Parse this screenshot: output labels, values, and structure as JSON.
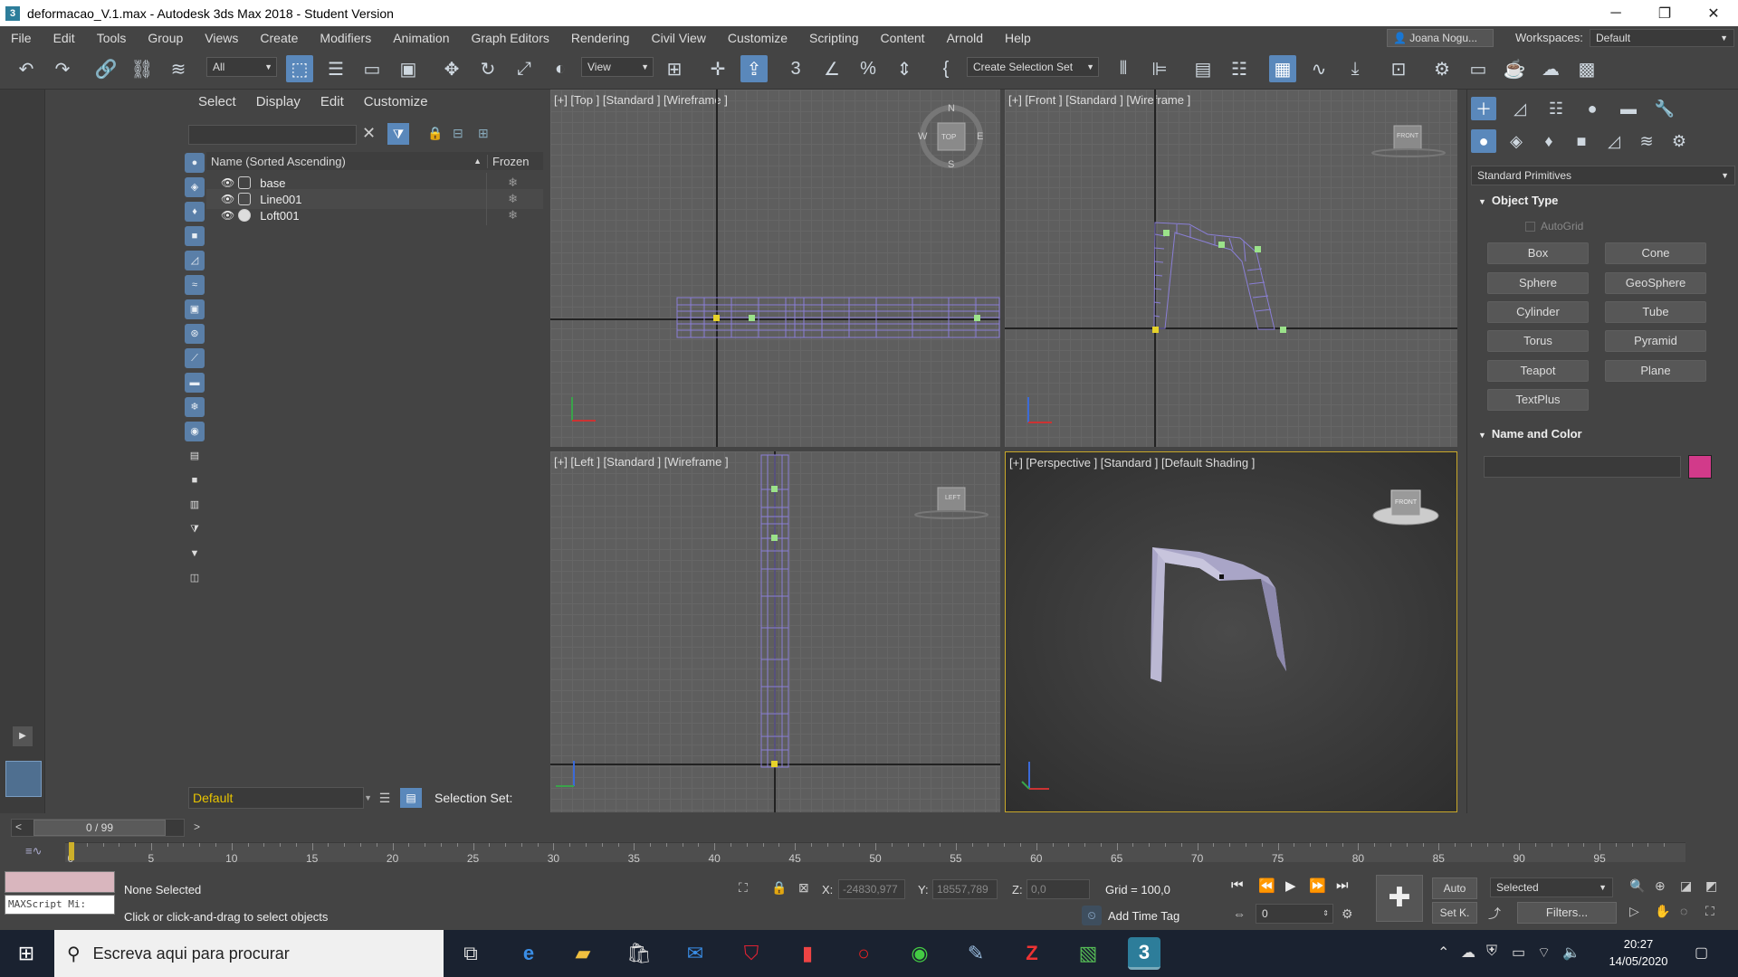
{
  "window": {
    "title": "deformacao_V.1.max - Autodesk 3ds Max 2018 - Student Version",
    "app_icon_text": "3",
    "controls": [
      "─",
      "❐",
      "✕"
    ]
  },
  "menu": {
    "items": [
      "File",
      "Edit",
      "Tools",
      "Group",
      "Views",
      "Create",
      "Modifiers",
      "Animation",
      "Graph Editors",
      "Rendering",
      "Civil View",
      "Customize",
      "Scripting",
      "Content",
      "Arnold",
      "Help"
    ],
    "user": "Joana Nogu...",
    "workspaces_label": "Workspaces:",
    "workspace_value": "Default"
  },
  "toolbar": {
    "filter_value": "All",
    "refcoord_value": "View",
    "selection_set_placeholder": "Create Selection Set",
    "icons": [
      "undo-icon",
      "redo-icon",
      "link-icon",
      "unlink-icon",
      "bind-spacewarp-icon",
      "select-object-icon",
      "select-by-name-icon",
      "rect-selection-icon",
      "window-crossing-icon",
      "move-icon",
      "rotate-icon",
      "scale-icon",
      "placement-icon",
      "pivot-icon",
      "keyboard-shortcut-icon",
      "snap-3d-icon",
      "angle-snap-icon",
      "percent-snap-icon",
      "spinner-snap-icon",
      "edit-named-sel-icon",
      "mirror-icon",
      "align-icon",
      "toggle-scene-explorer-icon",
      "toggle-layer-explorer-icon",
      "toggle-ribbon-icon",
      "curve-editor-icon",
      "schematic-view-icon",
      "material-editor-icon",
      "render-setup-icon",
      "rendered-frame-icon",
      "render-icon",
      "render-cloud-icon",
      "render-iterative-icon",
      "a360-gallery-icon"
    ]
  },
  "explorer": {
    "tabs": [
      "Select",
      "Display",
      "Edit",
      "Customize"
    ],
    "col_name": "Name (Sorted Ascending)",
    "col_frozen": "Frozen",
    "rows": [
      {
        "name": "base",
        "type": "shape"
      },
      {
        "name": "Line001",
        "type": "shape"
      },
      {
        "name": "Loft001",
        "type": "geometry"
      }
    ],
    "layer_value": "Default",
    "selection_set_label": "Selection Set:"
  },
  "viewports": {
    "top": "[+] [Top ] [Standard ] [Wireframe ]",
    "front": "[+] [Front ] [Standard ] [Wireframe ]",
    "left": "[+] [Left ] [Standard ] [Wireframe ]",
    "perspective": "[+] [Perspective ] [Standard ] [Default Shading ]",
    "compass": {
      "n": "N",
      "s": "S",
      "e": "E",
      "w": "W",
      "top": "TOP"
    },
    "viewcube_front": "FRONT",
    "viewcube_left": "LEFT",
    "viewcube_persp": "FRONT"
  },
  "command_panel": {
    "category": "Standard Primitives",
    "object_type_title": "Object Type",
    "autogrid": "AutoGrid",
    "buttons": [
      "Box",
      "Cone",
      "Sphere",
      "GeoSphere",
      "Cylinder",
      "Tube",
      "Torus",
      "Pyramid",
      "Teapot",
      "Plane",
      "TextPlus"
    ],
    "name_color_title": "Name and Color",
    "object_color": "#d23a8a"
  },
  "timeline": {
    "frame_display": "0 / 99",
    "ticks": [
      "0",
      "5",
      "10",
      "15",
      "20",
      "25",
      "30",
      "35",
      "40",
      "45",
      "50",
      "55",
      "60",
      "65",
      "70",
      "75",
      "80",
      "85",
      "90",
      "95"
    ],
    "frame_count": 100,
    "current_frame": 0
  },
  "status": {
    "maxscript": "MAXScript Mi:",
    "selection": "None Selected",
    "prompt": "Click or click-and-drag to select objects",
    "x_label": "X:",
    "x_value": "-24830,977",
    "y_label": "Y:",
    "y_value": "18557,789",
    "z_label": "Z:",
    "z_value": "0,0",
    "grid": "Grid = 100,0",
    "add_time_tag": "Add Time Tag",
    "frame_field": "0",
    "auto_key": "Auto",
    "set_key": "Set K.",
    "key_filter_value": "Selected",
    "filters": "Filters..."
  },
  "taskbar": {
    "search_placeholder": "Escreva aqui para procurar",
    "time": "20:27",
    "date": "14/05/2020"
  }
}
